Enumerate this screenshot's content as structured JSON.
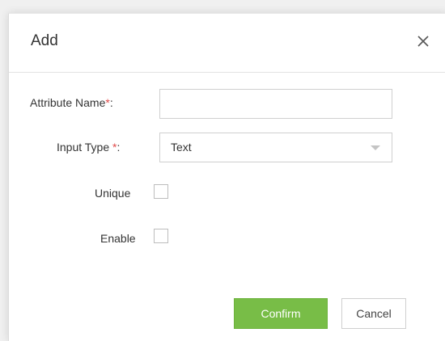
{
  "dialog": {
    "title": "Add",
    "close_icon": "close-icon"
  },
  "form": {
    "attribute_name": {
      "label": "Attribute Name",
      "required_mark": "*",
      "suffix": ":",
      "value": ""
    },
    "input_type": {
      "label": "Input Type ",
      "required_mark": "*",
      "suffix": ":",
      "selected": "Text"
    },
    "unique": {
      "label": "Unique",
      "checked": false
    },
    "enable": {
      "label": "Enable",
      "checked": false
    }
  },
  "buttons": {
    "confirm_label": "Confirm",
    "cancel_label": "Cancel"
  },
  "colors": {
    "primary_button": "#78bd47",
    "required_mark": "#e04a4a"
  }
}
